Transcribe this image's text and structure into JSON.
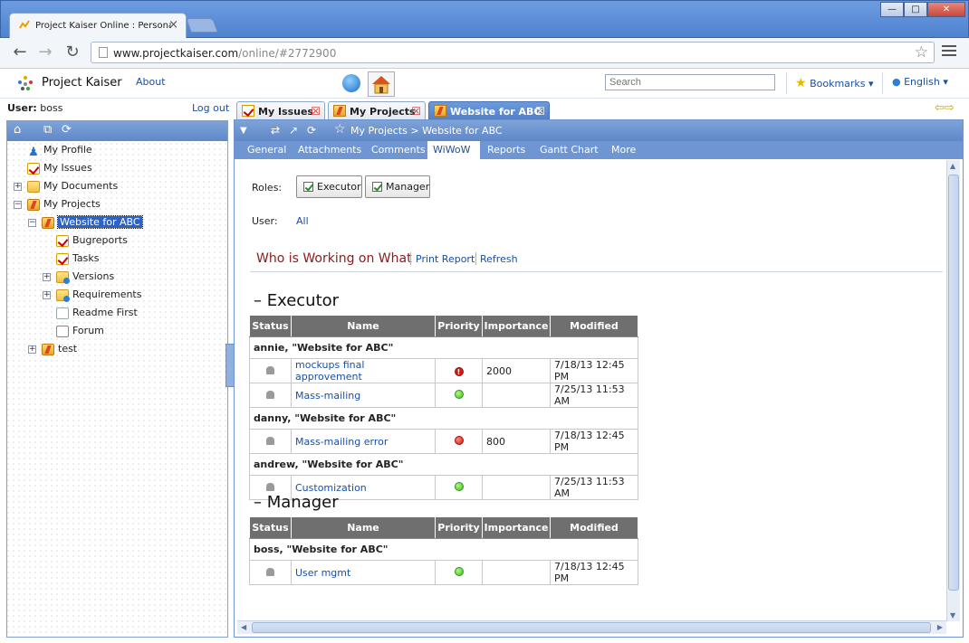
{
  "browser": {
    "tab_title": "Project Kaiser Online : Persona",
    "url_host": "www.projectkaiser.com",
    "url_path": "/online/#2772900",
    "window_buttons": [
      "—",
      "□",
      "✕"
    ]
  },
  "app": {
    "name": "Project Kaiser",
    "about": "About",
    "search_placeholder": "Search",
    "bookmarks": "Bookmarks ▾",
    "language": "English ▾"
  },
  "user": {
    "label": "User:",
    "name": "boss",
    "logout": "Log out"
  },
  "tree": {
    "my_profile": "My Profile",
    "my_issues": "My Issues",
    "my_documents": "My Documents",
    "my_projects": "My Projects",
    "website": "Website for ABC",
    "bugreports": "Bugreports",
    "tasks": "Tasks",
    "versions": "Versions",
    "requirements": "Requirements",
    "readme": "Readme First",
    "forum": "Forum",
    "test": "test"
  },
  "panel_tabs": [
    "My Issues",
    "My Projects",
    "Website for ABC"
  ],
  "breadcrumb": "My Projects > Website for ABC",
  "sub_tabs": [
    "General",
    "Attachments",
    "Comments",
    "WiWoW",
    "Reports",
    "Gantt Chart",
    "More"
  ],
  "roles": {
    "label": "Roles:",
    "executor": "Executor",
    "manager": "Manager"
  },
  "user_filter": {
    "label": "User:",
    "value": "All"
  },
  "wiwo": {
    "title": "Who is Working on What",
    "print": "Print Report",
    "refresh": "Refresh"
  },
  "columns": [
    "Status",
    "Name",
    "Priority",
    "Importance",
    "Modified"
  ],
  "executor": {
    "heading": "– Executor",
    "groups": [
      {
        "title": "annie, \"Website for ABC\"",
        "rows": [
          {
            "name": "mockups final approvement",
            "priority": "urgent",
            "importance": "2000",
            "modified": "7/18/13 12:45 PM"
          },
          {
            "name": "Mass-mailing",
            "priority": "normal",
            "importance": "",
            "modified": "7/25/13 11:53 AM"
          }
        ]
      },
      {
        "title": "danny, \"Website for ABC\"",
        "rows": [
          {
            "name": "Mass-mailing error",
            "priority": "high",
            "importance": "800",
            "modified": "7/18/13 12:45 PM"
          }
        ]
      },
      {
        "title": "andrew, \"Website for ABC\"",
        "rows": [
          {
            "name": "Customization",
            "priority": "normal",
            "importance": "",
            "modified": "7/25/13 11:53 AM"
          }
        ]
      }
    ]
  },
  "manager": {
    "heading": "– Manager",
    "groups": [
      {
        "title": "boss, \"Website for ABC\"",
        "rows": [
          {
            "name": "User mgmt",
            "priority": "normal",
            "importance": "",
            "modified": "7/18/13 12:45 PM"
          }
        ]
      }
    ]
  },
  "icons": {
    "back": "←",
    "forward": "→",
    "reload": "↻",
    "home": "⌂",
    "star": "☆",
    "panel_refresh": "⟳",
    "panel_copy": "⧉",
    "down": "▼",
    "swap": "⇄",
    "popout": "↗",
    "left_arrow": "◀",
    "right_arrow": "▶",
    "up_arrow": "▲",
    "down_arrow": "▼",
    "bell": "bell-icon",
    "nav_arrows": "⇦⇨"
  },
  "colors": {
    "accent": "#6f96d2",
    "link": "#1a4fa3",
    "header_gray": "#6f6f6f",
    "wiwo_title": "#8b1a1a"
  }
}
